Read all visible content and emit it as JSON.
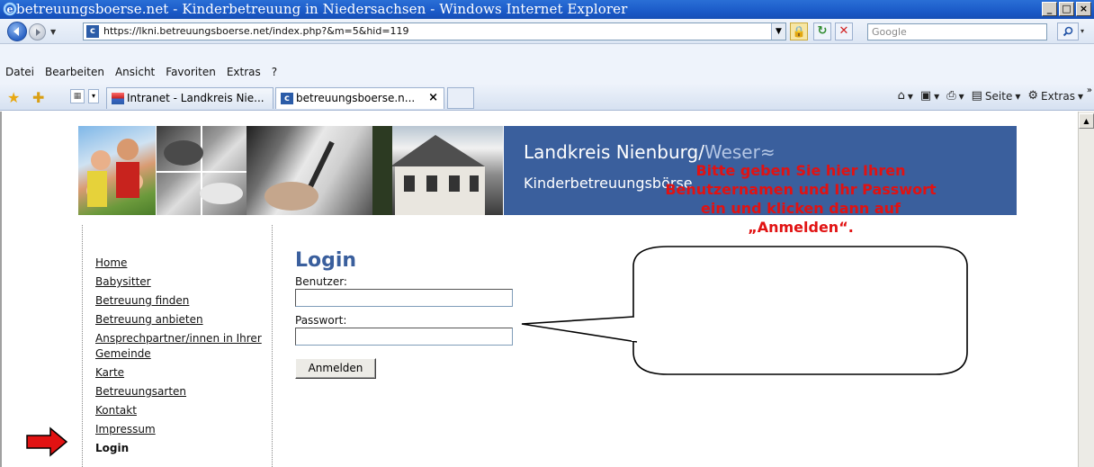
{
  "window": {
    "title": "betreuungsboerse.net - Kinderbetreuung in Niedersachsen - Windows Internet Explorer",
    "controls": [
      "_",
      "□",
      "×"
    ]
  },
  "toolbar": {
    "url": "https://lkni.betreuungsboerse.net/index.php?&m=5&hid=119",
    "search_placeholder": "Google",
    "icons": [
      "back-icon",
      "forward-icon",
      "lock-icon",
      "refresh-icon",
      "stop-icon",
      "search-icon"
    ]
  },
  "menubar": {
    "items": [
      "Datei",
      "Bearbeiten",
      "Ansicht",
      "Favoriten",
      "Extras",
      "?"
    ]
  },
  "tabs": [
    {
      "label": "Intranet - Landkreis Nie...",
      "active": false
    },
    {
      "label": "betreuungsboerse.n...",
      "active": true,
      "close": "×"
    }
  ],
  "commandbar": {
    "page_label": "Seite",
    "extras_label": "Extras"
  },
  "banner": {
    "brand_main": "Landkreis Nienburg",
    "brand_sep": "/",
    "brand_sub": "Weser",
    "brand_wave": "≈",
    "subtitle": "Kinderbetreuungsbörse",
    "brand_color": "#3a5f9d"
  },
  "sidebar": {
    "items": [
      {
        "label": "Home",
        "active": false
      },
      {
        "label": "Babysitter",
        "active": false
      },
      {
        "label": "Betreuung finden",
        "active": false
      },
      {
        "label": "Betreuung anbieten",
        "active": false
      },
      {
        "label": "Ansprechpartner/innen in Ihrer Gemeinde",
        "active": false
      },
      {
        "label": "Karte",
        "active": false
      },
      {
        "label": "Betreuungsarten",
        "active": false
      },
      {
        "label": "Kontakt",
        "active": false
      },
      {
        "label": "Impressum",
        "active": false
      },
      {
        "label": "Login",
        "active": true
      }
    ]
  },
  "login": {
    "title": "Login",
    "user_label": "Benutzer:",
    "user_value": "",
    "password_label": "Passwort:",
    "password_value": "",
    "submit_label": "Anmelden"
  },
  "callout": {
    "text": "Bitte geben Sie hier Ihren Benutzernamen und Ihr Passwort ein und klicken dann auf „Anmelden“.",
    "color": "#e11212"
  }
}
